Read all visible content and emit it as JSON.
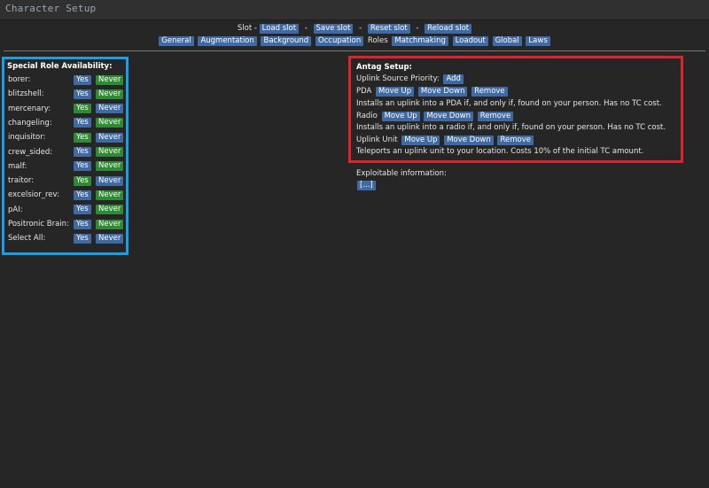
{
  "window": {
    "title": "Character Setup"
  },
  "slot": {
    "label": "Slot -",
    "buttons": [
      "Load slot",
      "Save slot",
      "Reset slot",
      "Reload slot"
    ]
  },
  "tabs": {
    "before_current": [
      "General",
      "Augmentation",
      "Background",
      "Occupation"
    ],
    "current": "Roles",
    "after_current": [
      "Matchmaking",
      "Loadout",
      "Global",
      "Laws"
    ]
  },
  "roles": {
    "heading": "Special Role Availability:",
    "yes_label": "Yes",
    "never_label": "Never",
    "items": [
      {
        "name": "borer:",
        "selected": "never"
      },
      {
        "name": "blitzshell:",
        "selected": "never"
      },
      {
        "name": "mercenary:",
        "selected": "yes"
      },
      {
        "name": "changeling:",
        "selected": "never"
      },
      {
        "name": "inquisitor:",
        "selected": "yes"
      },
      {
        "name": "crew_sided:",
        "selected": "never"
      },
      {
        "name": "malf:",
        "selected": "never"
      },
      {
        "name": "traitor:",
        "selected": "yes"
      },
      {
        "name": "excelsior_rev:",
        "selected": "never"
      },
      {
        "name": "pAI:",
        "selected": "never"
      },
      {
        "name": "Positronic Brain:",
        "selected": "never"
      },
      {
        "name": "Select All:",
        "selected": "none"
      }
    ]
  },
  "antag": {
    "heading": "Antag Setup:",
    "priority_label": "Uplink Source Priority:",
    "add_label": "Add",
    "move_up_label": "Move Up",
    "move_down_label": "Move Down",
    "remove_label": "Remove",
    "sources": [
      {
        "name": "PDA",
        "description": "Installs an uplink into a PDA if, and only if, found on your person. Has no TC cost."
      },
      {
        "name": "Radio",
        "description": "Installs an uplink into a radio if, and only if, found on your person. Has no TC cost."
      },
      {
        "name": "Uplink Unit",
        "description": "Teleports an uplink unit to your location. Costs 10% of the initial TC amount."
      }
    ]
  },
  "exploitable": {
    "label": "Exploitable information:",
    "button": "[...]"
  },
  "colors": {
    "background": "#262626",
    "button_blue": "#3f6aa3",
    "button_green": "#2f8a34",
    "highlight_blue": "#1a9ee6",
    "highlight_red": "#e2222a"
  }
}
